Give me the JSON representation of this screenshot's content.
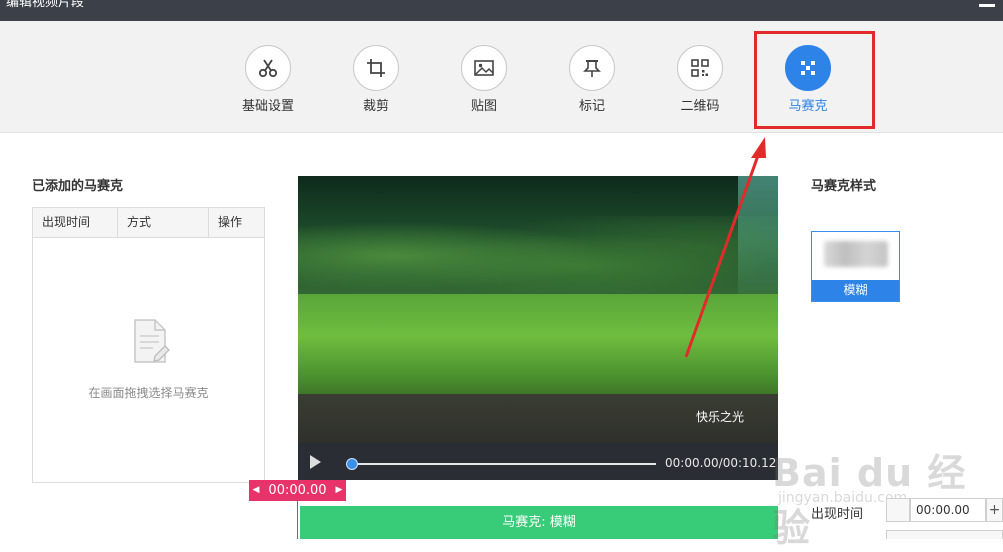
{
  "window": {
    "title": "编辑视频片段"
  },
  "toolbar": {
    "tools": [
      {
        "label": "基础设置",
        "icon": "scissors-icon"
      },
      {
        "label": "裁剪",
        "icon": "crop-icon"
      },
      {
        "label": "贴图",
        "icon": "image-icon"
      },
      {
        "label": "标记",
        "icon": "pin-icon"
      },
      {
        "label": "二维码",
        "icon": "qrcode-icon"
      },
      {
        "label": "马赛克",
        "icon": "mosaic-icon",
        "active": true
      }
    ],
    "active_color": "#2d83e8",
    "highlight_color": "#e12b2b"
  },
  "left_panel": {
    "title": "已添加的马赛克",
    "columns": [
      "出现时间",
      "方式",
      "操作"
    ],
    "empty_hint": "在画面拖拽选择马赛克"
  },
  "video": {
    "subtitle": "快乐之光",
    "time_display": "00:00.00/00:10.12",
    "progress": 0
  },
  "timeline": {
    "current_time": "00:00.00",
    "mosaic_bar_label": "马赛克: 模糊",
    "marker_color": "#e8336a",
    "bar_color": "#38cc78"
  },
  "right_panel": {
    "title": "马赛克样式",
    "style_option": "模糊",
    "appear_label": "出现时间",
    "appear_value": "00:00.00",
    "plus": "+"
  },
  "watermark": {
    "text": "Bai du 经验",
    "sub": "jingyan.baidu.com"
  }
}
